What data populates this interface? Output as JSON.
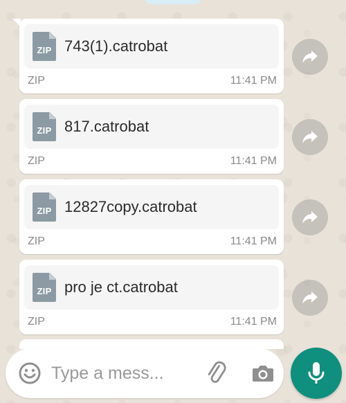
{
  "messages": [
    {
      "filename": "743(1).catrobat",
      "type_label": "ZIP",
      "icon_label": "ZIP",
      "time": "11:41 PM"
    },
    {
      "filename": "817.catrobat",
      "type_label": "ZIP",
      "icon_label": "ZIP",
      "time": "11:41 PM"
    },
    {
      "filename": "12827copy.catrobat",
      "type_label": "ZIP",
      "icon_label": "ZIP",
      "time": "11:41 PM"
    },
    {
      "filename": "pro je ct.catrobat",
      "type_label": "ZIP",
      "icon_label": "ZIP",
      "time": "11:41 PM"
    }
  ],
  "composer": {
    "placeholder": "Type a mess...",
    "value": ""
  },
  "icons": {
    "emoji": "emoji-icon",
    "attach": "paperclip-icon",
    "camera": "camera-icon",
    "mic": "microphone-icon",
    "forward": "forward-arrow-icon",
    "file": "zip-file-icon"
  },
  "colors": {
    "background": "#e9e2d9",
    "bubble": "#ffffff",
    "doc_card": "#f5f5f5",
    "zip_icon": "#8b9aa3",
    "meta_text": "#8a8a8a",
    "mic_button": "#0f8f7e",
    "forward_button": "#a8a8a8"
  }
}
